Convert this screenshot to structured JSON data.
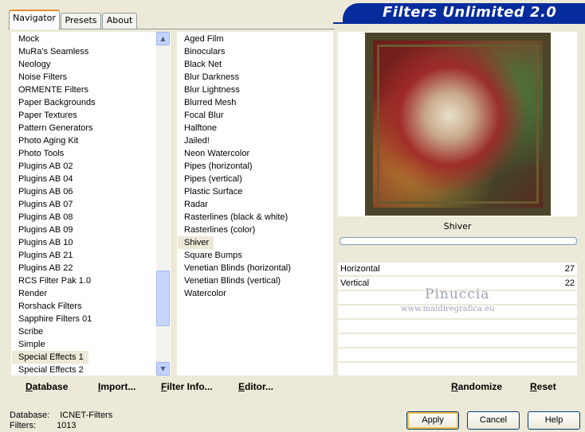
{
  "tabs": [
    {
      "label": "Navigator",
      "active": true
    },
    {
      "label": "Presets",
      "active": false
    },
    {
      "label": "About",
      "active": false
    }
  ],
  "banner": {
    "title": "Filters Unlimited 2.0",
    "color": "#062b9c"
  },
  "categories": {
    "items": [
      "Mock",
      "MuRa's Seamless",
      "Neology",
      "Noise Filters",
      "ORMENTE Filters",
      "Paper Backgrounds",
      "Paper Textures",
      "Pattern Generators",
      "Photo Aging Kit",
      "Photo Tools",
      "Plugins AB 02",
      "Plugins AB 04",
      "Plugins AB 06",
      "Plugins AB 07",
      "Plugins AB 08",
      "Plugins AB 09",
      "Plugins AB 10",
      "Plugins AB 21",
      "Plugins AB 22",
      "RCS Filter Pak 1.0",
      "Render",
      "Rorshack Filters",
      "Sapphire Filters 01",
      "Scribe",
      "Simple",
      "Special Effects 1",
      "Special Effects 2"
    ],
    "selected": "Special Effects 1"
  },
  "filters": {
    "items": [
      "Aged Film",
      "Binoculars",
      "Black Net",
      "Blur Darkness",
      "Blur Lightness",
      "Blurred Mesh",
      "Focal Blur",
      "Halftone",
      "Jailed!",
      "Neon Watercolor",
      "Pipes (horizontal)",
      "Pipes (vertical)",
      "Plastic Surface",
      "Radar",
      "Rasterlines (black & white)",
      "Rasterlines (color)",
      "Shiver",
      "Square Bumps",
      "Venetian Blinds (horizontal)",
      "Venetian Blinds (vertical)",
      "Watercolor"
    ],
    "selected": "Shiver"
  },
  "preview": {
    "filter_name": "Shiver"
  },
  "params": [
    {
      "label": "Horizontal",
      "value": "27"
    },
    {
      "label": "Vertical",
      "value": "22"
    }
  ],
  "watermark": {
    "name": "Pinuccia",
    "url": "www.maidiregrafica.eu"
  },
  "toolbar": {
    "database": "Database",
    "import": "Import...",
    "filter_info": "Filter Info...",
    "editor": "Editor...",
    "randomize": "Randomize",
    "reset": "Reset"
  },
  "status": {
    "database_label": "Database:",
    "database_value": "ICNET-Filters",
    "filters_label": "Filters:",
    "filters_value": "1013"
  },
  "buttons": {
    "apply": "Apply",
    "cancel": "Cancel",
    "help": "Help"
  }
}
